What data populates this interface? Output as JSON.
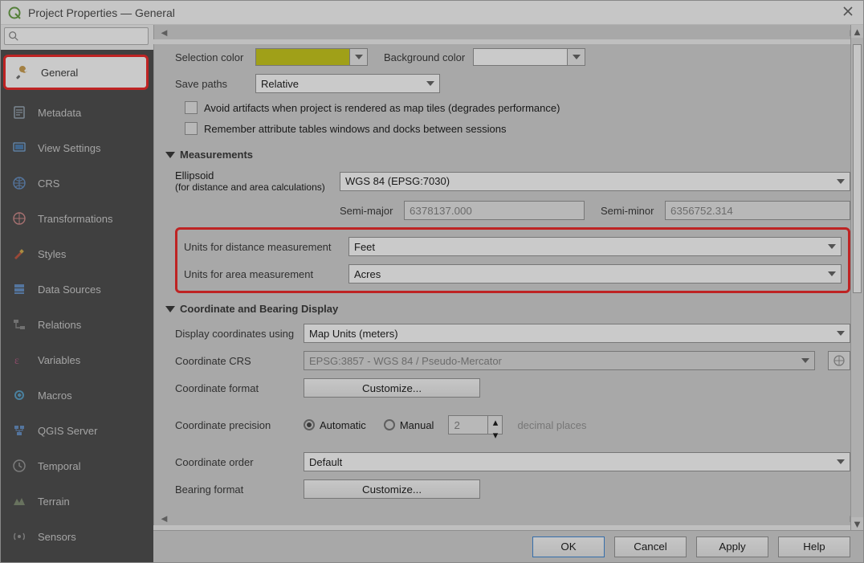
{
  "window": {
    "title": "Project Properties — General"
  },
  "sidebar": {
    "search_placeholder": "",
    "items": [
      {
        "label": "General",
        "icon": "wrench"
      },
      {
        "label": "Metadata",
        "icon": "doc"
      },
      {
        "label": "View Settings",
        "icon": "monitor"
      },
      {
        "label": "CRS",
        "icon": "globe"
      },
      {
        "label": "Transformations",
        "icon": "globe2"
      },
      {
        "label": "Styles",
        "icon": "brush"
      },
      {
        "label": "Data Sources",
        "icon": "db"
      },
      {
        "label": "Relations",
        "icon": "rel"
      },
      {
        "label": "Variables",
        "icon": "eps"
      },
      {
        "label": "Macros",
        "icon": "gear"
      },
      {
        "label": "QGIS Server",
        "icon": "server"
      },
      {
        "label": "Temporal",
        "icon": "clock"
      },
      {
        "label": "Terrain",
        "icon": "terrain"
      },
      {
        "label": "Sensors",
        "icon": "sensor"
      }
    ]
  },
  "top": {
    "selection_color_label": "Selection color",
    "background_color_label": "Background color",
    "save_paths_label": "Save paths",
    "save_paths_value": "Relative",
    "chk_tiles": "Avoid artifacts when project is rendered as map tiles (degrades performance)",
    "chk_remember": "Remember attribute tables windows and docks between sessions"
  },
  "measurements": {
    "header": "Measurements",
    "ellipsoid_label": "Ellipsoid",
    "ellipsoid_sub": "(for distance and area calculations)",
    "ellipsoid_value": "WGS 84 (EPSG:7030)",
    "semimajor_label": "Semi-major",
    "semimajor_value": "6378137.000",
    "semiminor_label": "Semi-minor",
    "semiminor_value": "6356752.314",
    "dist_label": "Units for distance measurement",
    "dist_value": "Feet",
    "area_label": "Units for area measurement",
    "area_value": "Acres"
  },
  "coord": {
    "header": "Coordinate and Bearing Display",
    "display_using_label": "Display coordinates using",
    "display_using_value": "Map Units (meters)",
    "coord_crs_label": "Coordinate CRS",
    "coord_crs_value": "EPSG:3857 - WGS 84 / Pseudo-Mercator",
    "coord_format_label": "Coordinate format",
    "customize_btn": "Customize...",
    "coord_precision_label": "Coordinate precision",
    "automatic": "Automatic",
    "manual": "Manual",
    "decimal_places": "decimal places",
    "decimal_value": "2",
    "coord_order_label": "Coordinate order",
    "coord_order_value": "Default",
    "bearing_label": "Bearing format"
  },
  "buttons": {
    "ok": "OK",
    "cancel": "Cancel",
    "apply": "Apply",
    "help": "Help"
  }
}
